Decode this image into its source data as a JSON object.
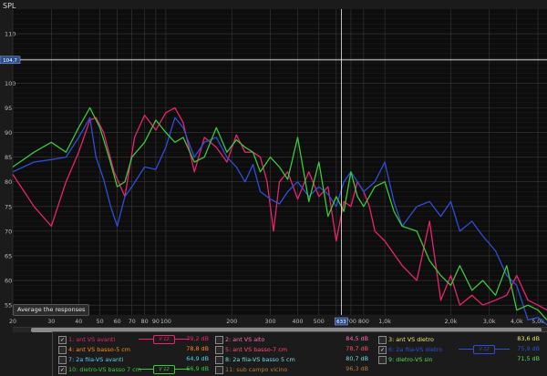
{
  "chart_data": {
    "type": "line",
    "title": "SPL",
    "xlabel": "",
    "ylabel": "",
    "x_scale": "log",
    "xlim": [
      20,
      5500
    ],
    "ylim": [
      53,
      115
    ],
    "x_ticks": [
      20,
      30,
      40,
      50,
      60,
      70,
      80,
      90,
      100,
      200,
      300,
      400,
      500,
      600,
      700,
      800,
      1000,
      2000,
      3000,
      4000,
      5000
    ],
    "x_tick_labels": [
      "20",
      "30",
      "40",
      "50",
      "60",
      "70",
      "80",
      "90",
      "100",
      "200",
      "300",
      "400",
      "500",
      "6",
      "700",
      "800",
      "1,0k",
      "2,0k",
      "3,0k",
      "4,0k",
      "5,0k"
    ],
    "y_ticks": [
      55,
      60,
      65,
      70,
      75,
      80,
      85,
      90,
      95,
      100,
      105,
      110
    ],
    "y_tick_labels": [
      "55",
      "60",
      "65",
      "70",
      "75",
      "80",
      "85",
      "90",
      "95",
      "100",
      "105",
      "110"
    ],
    "cursor": {
      "x": 633,
      "x_label": "633",
      "y": 104.7,
      "y_label": "104,7"
    },
    "series": [
      {
        "name": "1: ant VS avanti",
        "color": "#e8246e",
        "x": [
          20,
          25,
          30,
          35,
          40,
          45,
          48,
          52,
          58,
          65,
          72,
          80,
          90,
          100,
          110,
          120,
          135,
          150,
          170,
          190,
          210,
          230,
          250,
          270,
          290,
          310,
          330,
          360,
          400,
          450,
          500,
          550,
          600,
          650,
          700,
          750,
          800,
          850,
          900,
          1000,
          1200,
          1400,
          1600,
          1800,
          2000,
          2200,
          2500,
          2800,
          3200,
          3600,
          4000,
          4500,
          5000,
          5500
        ],
        "y": [
          81.5,
          75,
          71,
          80,
          86,
          92.5,
          93,
          90,
          82,
          77,
          89,
          93.5,
          90.5,
          94,
          95,
          92,
          82,
          89,
          87,
          84,
          89.5,
          86,
          86,
          85,
          80,
          70,
          80,
          82,
          76.5,
          82,
          77,
          79,
          68,
          76,
          75,
          80,
          78,
          75,
          70,
          68,
          63,
          60,
          72,
          56,
          61,
          55,
          57,
          55,
          56,
          57,
          61,
          56,
          55,
          54
        ]
      },
      {
        "name": "2: ant VS alto",
        "color": "#ff69b4",
        "x": [],
        "y": []
      },
      {
        "name": "3: ant VS dietro",
        "color": "#e8e86a",
        "x": [],
        "y": []
      },
      {
        "name": "4: ant VS basso-5 cm",
        "color": "#ff8c1a",
        "x": [],
        "y": []
      },
      {
        "name": "5: ant VS basso-7 cm",
        "color": "#ff4d6a",
        "x": [],
        "y": []
      },
      {
        "name": "6: 2a fila-VS dietro",
        "color": "#2d4fd8",
        "x": [
          20,
          25,
          30,
          35,
          40,
          45,
          48,
          52,
          56,
          60,
          65,
          70,
          80,
          90,
          100,
          110,
          120,
          135,
          150,
          170,
          190,
          210,
          230,
          250,
          270,
          300,
          330,
          360,
          400,
          450,
          500,
          550,
          600,
          650,
          700,
          750,
          800,
          900,
          1000,
          1100,
          1200,
          1400,
          1600,
          1800,
          2000,
          2200,
          2500,
          2800,
          3200,
          3600,
          4000,
          4500,
          5000,
          5500
        ],
        "y": [
          82,
          84,
          84.5,
          85,
          89,
          93,
          85,
          80.5,
          75,
          71,
          77,
          79,
          83,
          82.5,
          87,
          93,
          91,
          85,
          88,
          89,
          85,
          83,
          80,
          83.5,
          78,
          76.5,
          75.5,
          78,
          80,
          77,
          79,
          77.5,
          75,
          80,
          82,
          80,
          78,
          80,
          84,
          76,
          71,
          75,
          76,
          73,
          76,
          70,
          72,
          69,
          66,
          61,
          59,
          52,
          52.5,
          51
        ]
      },
      {
        "name": "7: 2a fila-VS avanti",
        "color": "#5ad0f0",
        "x": [],
        "y": []
      },
      {
        "name": "8: 2a fila-VS basso 5 cm",
        "color": "#7ad8e8",
        "x": [],
        "y": []
      },
      {
        "name": "9: dietro-VS sin",
        "color": "#5ad85a",
        "x": [],
        "y": []
      },
      {
        "name": "10: dietro-VS basso 7 cm",
        "color": "#3cc83c",
        "x": [
          20,
          25,
          30,
          35,
          40,
          45,
          50,
          55,
          60,
          65,
          70,
          80,
          90,
          100,
          110,
          120,
          135,
          150,
          170,
          190,
          210,
          230,
          250,
          270,
          300,
          330,
          360,
          400,
          450,
          500,
          550,
          600,
          650,
          700,
          750,
          800,
          900,
          1000,
          1100,
          1200,
          1400,
          1600,
          1800,
          2000,
          2200,
          2500,
          2800,
          3200,
          3600,
          4000,
          4500,
          5000,
          5500
        ],
        "y": [
          83,
          86,
          88,
          86,
          91,
          95,
          91,
          85,
          79,
          80,
          85,
          88,
          92.5,
          90,
          88,
          89,
          84,
          85,
          91,
          86,
          88.5,
          87,
          86,
          82,
          85,
          83,
          80.5,
          89,
          76,
          84,
          73,
          77,
          74,
          82,
          77,
          75,
          79,
          80,
          74,
          71,
          70,
          64,
          61,
          59,
          63,
          58,
          60,
          57,
          63,
          54,
          55,
          54,
          52
        ]
      },
      {
        "name": "11: sub campo vicino",
        "color": "#b47a3c",
        "x": [],
        "y": []
      }
    ]
  },
  "legend": [
    {
      "name": "1: ant VS avanti",
      "checked": true,
      "value": "79,2 dB",
      "mark": "V 12",
      "color": "#e8246e"
    },
    {
      "name": "2: ant VS alto",
      "checked": false,
      "value": "84,5 dB",
      "mark": "",
      "color": "#ff69b4"
    },
    {
      "name": "3: ant VS dietro",
      "checked": false,
      "value": "83,6 dB",
      "mark": "",
      "color": "#e8e86a"
    },
    {
      "name": "4: ant VS basso-5 cm",
      "checked": false,
      "value": "78,8 dB",
      "mark": "",
      "color": "#ff8c1a"
    },
    {
      "name": "5: ant VS basso-7 cm",
      "checked": false,
      "value": "78,7 dB",
      "mark": "",
      "color": "#ff4d6a"
    },
    {
      "name": "6: 2a fila-VS dietro",
      "checked": true,
      "value": "75,9 dB",
      "mark": "V 12",
      "color": "#2d4fd8"
    },
    {
      "name": "7: 2a fila-VS avanti",
      "checked": false,
      "value": "64,9 dB",
      "mark": "",
      "color": "#5ad0f0"
    },
    {
      "name": "8: 2a fila-VS basso 5 cm",
      "checked": false,
      "value": "80,7 dB",
      "mark": "",
      "color": "#7ad8e8"
    },
    {
      "name": "9: dietro-VS sin",
      "checked": false,
      "value": "71,5 dB",
      "mark": "",
      "color": "#5ad85a"
    },
    {
      "name": "10: dietro-VS basso 7 cm",
      "checked": true,
      "value": "66,9 dB",
      "mark": "V 12",
      "color": "#3cc83c"
    },
    {
      "name": "11: sub campo vicino",
      "checked": false,
      "value": "96,3 dB",
      "mark": "",
      "color": "#b47a3c"
    }
  ],
  "ui": {
    "average_button": "Average the responses",
    "grid_color": "#3a3a3a",
    "background": "#0d0d0d"
  }
}
